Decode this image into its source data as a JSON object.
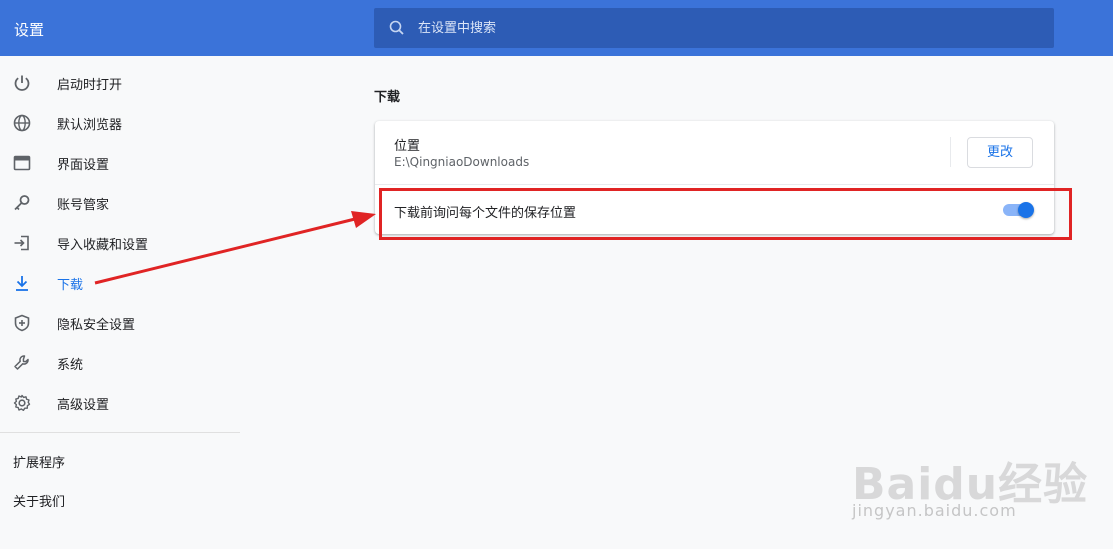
{
  "app": {
    "title": "设置"
  },
  "search": {
    "placeholder": "在设置中搜索"
  },
  "sidebar": {
    "items": [
      {
        "label": "启动时打开",
        "icon": "power-icon"
      },
      {
        "label": "默认浏览器",
        "icon": "globe-icon"
      },
      {
        "label": "界面设置",
        "icon": "window-icon"
      },
      {
        "label": "账号管家",
        "icon": "key-icon"
      },
      {
        "label": "导入收藏和设置",
        "icon": "import-icon"
      },
      {
        "label": "下载",
        "icon": "download-icon",
        "active": true
      },
      {
        "label": "隐私安全设置",
        "icon": "shield-plus-icon"
      },
      {
        "label": "系统",
        "icon": "wrench-icon"
      },
      {
        "label": "高级设置",
        "icon": "gear-icon"
      }
    ],
    "extensions_label": "扩展程序",
    "about_label": "关于我们"
  },
  "downloads": {
    "section_title": "下载",
    "location_label": "位置",
    "location_value": "E:\\QingniaoDownloads",
    "change_button": "更改",
    "ask_label": "下载前询问每个文件的保存位置",
    "ask_enabled": true
  },
  "watermark": {
    "logo_text": "Baidu经验",
    "url_text": "jingyan.baidu.com"
  },
  "colors": {
    "topbar": "#3b73d9",
    "search_bg": "#2d5cb5",
    "accent": "#1a73e8",
    "annotation": "#e02424"
  }
}
